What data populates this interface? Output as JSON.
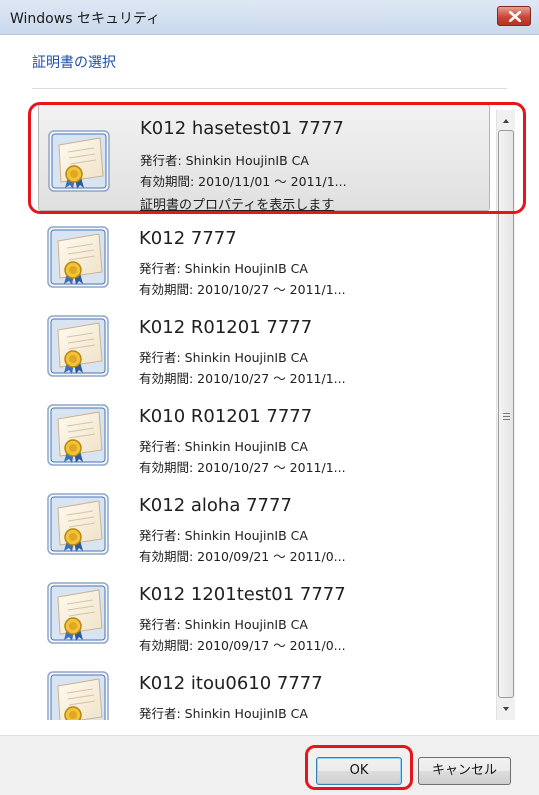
{
  "window": {
    "title": "Windows セキュリティ"
  },
  "dialog": {
    "subtitle": "証明書の選択"
  },
  "certificates": [
    {
      "name": "K012 hasetest01 7777",
      "issuer": "発行者: Shinkin HoujinIB CA",
      "validity": "有効期間: 2010/11/01 ～ 2011/1...",
      "link": "証明書のプロパティを表示します",
      "selected": true
    },
    {
      "name": "K012  7777",
      "issuer": "発行者: Shinkin HoujinIB CA",
      "validity": "有効期間: 2010/10/27 ～ 2011/1..."
    },
    {
      "name": "K012 R01201 7777",
      "issuer": "発行者: Shinkin HoujinIB CA",
      "validity": "有効期間: 2010/10/27 ～ 2011/1..."
    },
    {
      "name": "K010 R01201 7777",
      "issuer": "発行者: Shinkin HoujinIB CA",
      "validity": "有効期間: 2010/10/27 ～ 2011/1..."
    },
    {
      "name": "K012 aloha 7777",
      "issuer": "発行者: Shinkin HoujinIB CA",
      "validity": "有効期間: 2010/09/21 ～ 2011/0..."
    },
    {
      "name": "K012 1201test01 7777",
      "issuer": "発行者: Shinkin HoujinIB CA",
      "validity": "有効期間: 2010/09/17 ～ 2011/0..."
    },
    {
      "name": "K012 itou0610 7777",
      "issuer": "発行者: Shinkin HoujinIB CA",
      "validity": ""
    }
  ],
  "buttons": {
    "ok": "OK",
    "cancel": "キャンセル"
  },
  "colors": {
    "highlight": "#e8141b",
    "subtitle": "#1e4fa8"
  }
}
